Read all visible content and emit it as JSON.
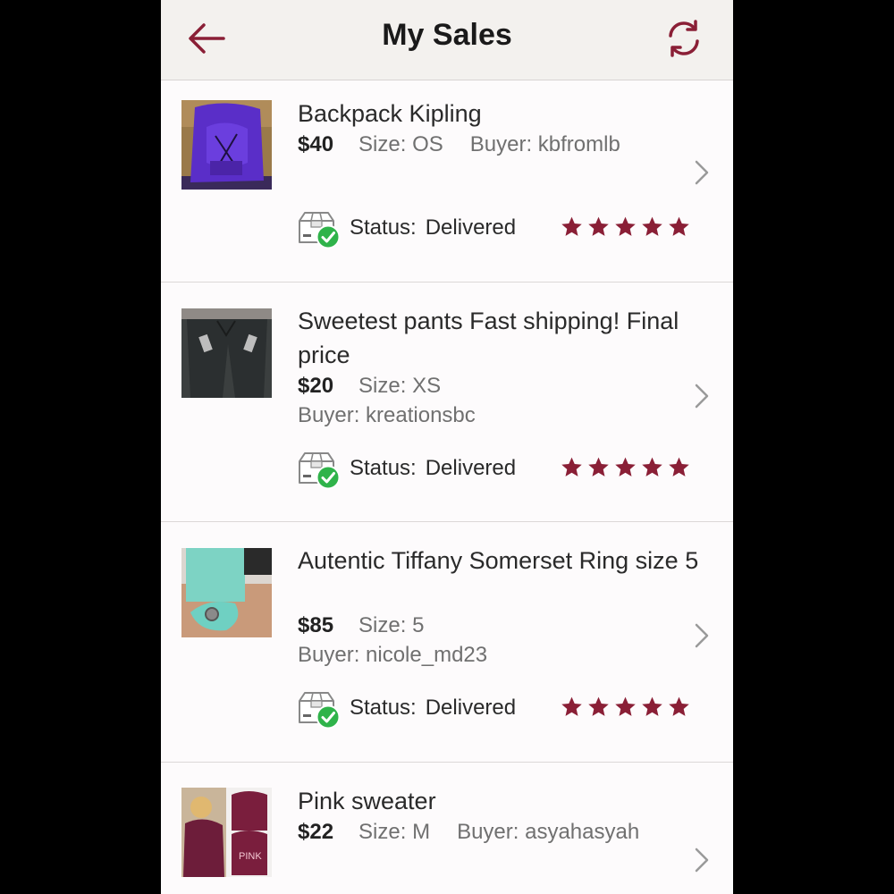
{
  "header": {
    "title": "My Sales"
  },
  "rating": {
    "value": 5,
    "max": 5
  },
  "colors": {
    "accent": "#8a1f36",
    "check": "#2fb34a"
  },
  "sales": [
    {
      "title": "Backpack Kipling",
      "price": "$40",
      "size": "Size: OS",
      "buyer": "Buyer: kbfromlb",
      "status_label": "Status:",
      "status": "Delivered",
      "rating": 5
    },
    {
      "title": "Sweetest pants Fast shipping! Final price",
      "price": "$20",
      "size": "Size: XS",
      "buyer": "Buyer: kreationsbc",
      "status_label": "Status:",
      "status": "Delivered",
      "rating": 5
    },
    {
      "title": "Autentic Tiffany Somerset Ring size 5",
      "price": "$85",
      "size": "Size: 5",
      "buyer": "Buyer: nicole_md23",
      "status_label": "Status:",
      "status": "Delivered",
      "rating": 5
    },
    {
      "title": "Pink sweater",
      "price": "$22",
      "size": "Size: M",
      "buyer": "Buyer: asyahasyah"
    }
  ]
}
